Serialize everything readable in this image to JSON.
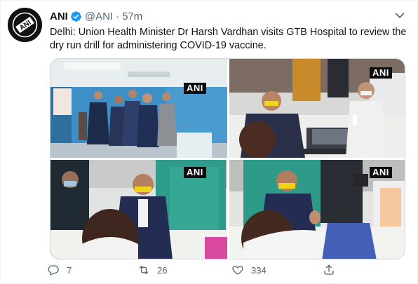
{
  "tweet": {
    "author_name": "ANI",
    "handle": "@ANI",
    "separator": "·",
    "time": "57m",
    "text": "Delhi: Union Health Minister Dr Harsh Vardhan visits GTB Hospital to review the dry run drill for administering COVID-19 vaccine.",
    "avatar_logo": "ANI"
  },
  "media": {
    "watermarks": [
      "ANI",
      "ANI",
      "ANI",
      "ANI"
    ]
  },
  "actions": {
    "reply_count": "7",
    "retweet_count": "26",
    "like_count": "334"
  },
  "icons": {
    "verified": "verified-badge-icon",
    "more": "chevron-down-icon",
    "reply": "reply-icon",
    "retweet": "retweet-icon",
    "like": "heart-icon",
    "share": "share-icon"
  },
  "colors": {
    "accent": "#1d9bf0",
    "text_primary": "#0f1419",
    "text_secondary": "#536471"
  }
}
